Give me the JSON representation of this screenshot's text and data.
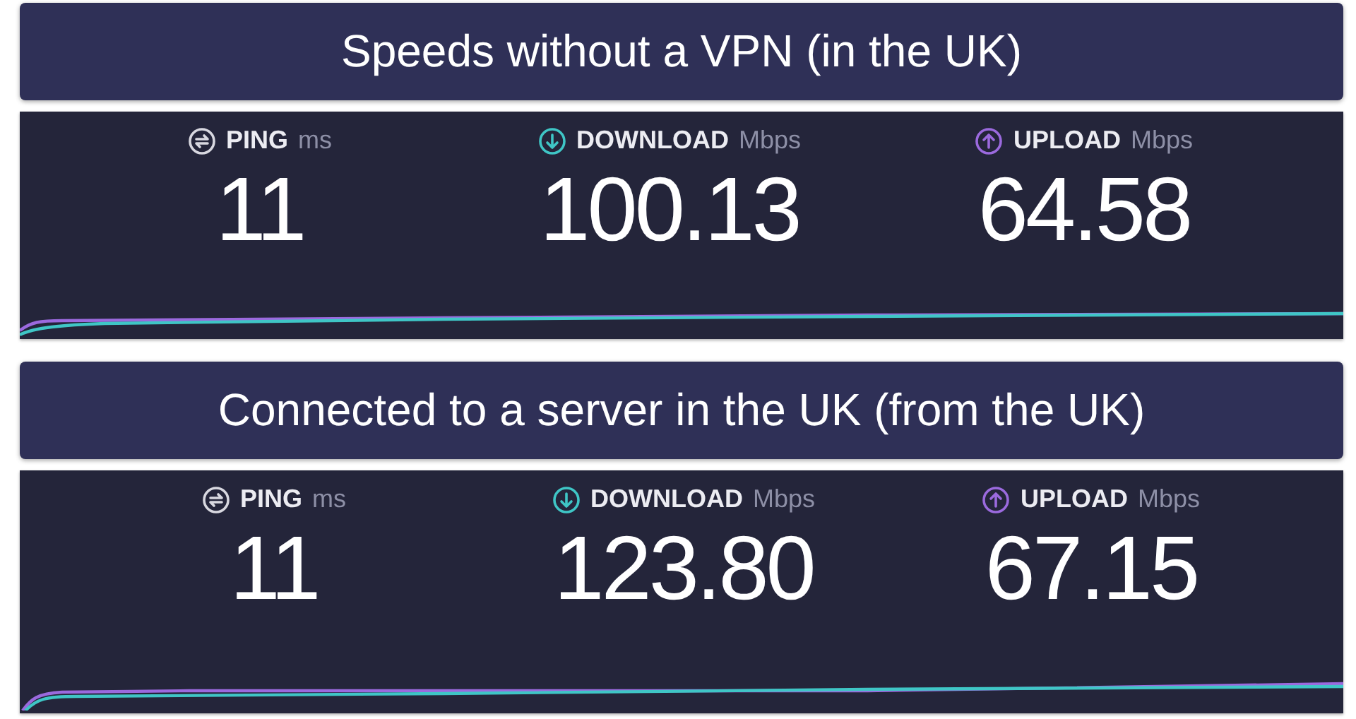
{
  "sections": [
    {
      "title": "Speeds without a VPN (in the UK)",
      "metrics": [
        {
          "kind": "ping",
          "label": "PING",
          "unit": "ms",
          "value": "11"
        },
        {
          "kind": "download",
          "label": "DOWNLOAD",
          "unit": "Mbps",
          "value": "100.13"
        },
        {
          "kind": "upload",
          "label": "UPLOAD",
          "unit": "Mbps",
          "value": "64.58"
        }
      ]
    },
    {
      "title": "Connected to a server in the UK (from the UK)",
      "metrics": [
        {
          "kind": "ping",
          "label": "PING",
          "unit": "ms",
          "value": "11"
        },
        {
          "kind": "download",
          "label": "DOWNLOAD",
          "unit": "Mbps",
          "value": "123.80"
        },
        {
          "kind": "upload",
          "label": "UPLOAD",
          "unit": "Mbps",
          "value": "67.15"
        }
      ]
    }
  ]
}
